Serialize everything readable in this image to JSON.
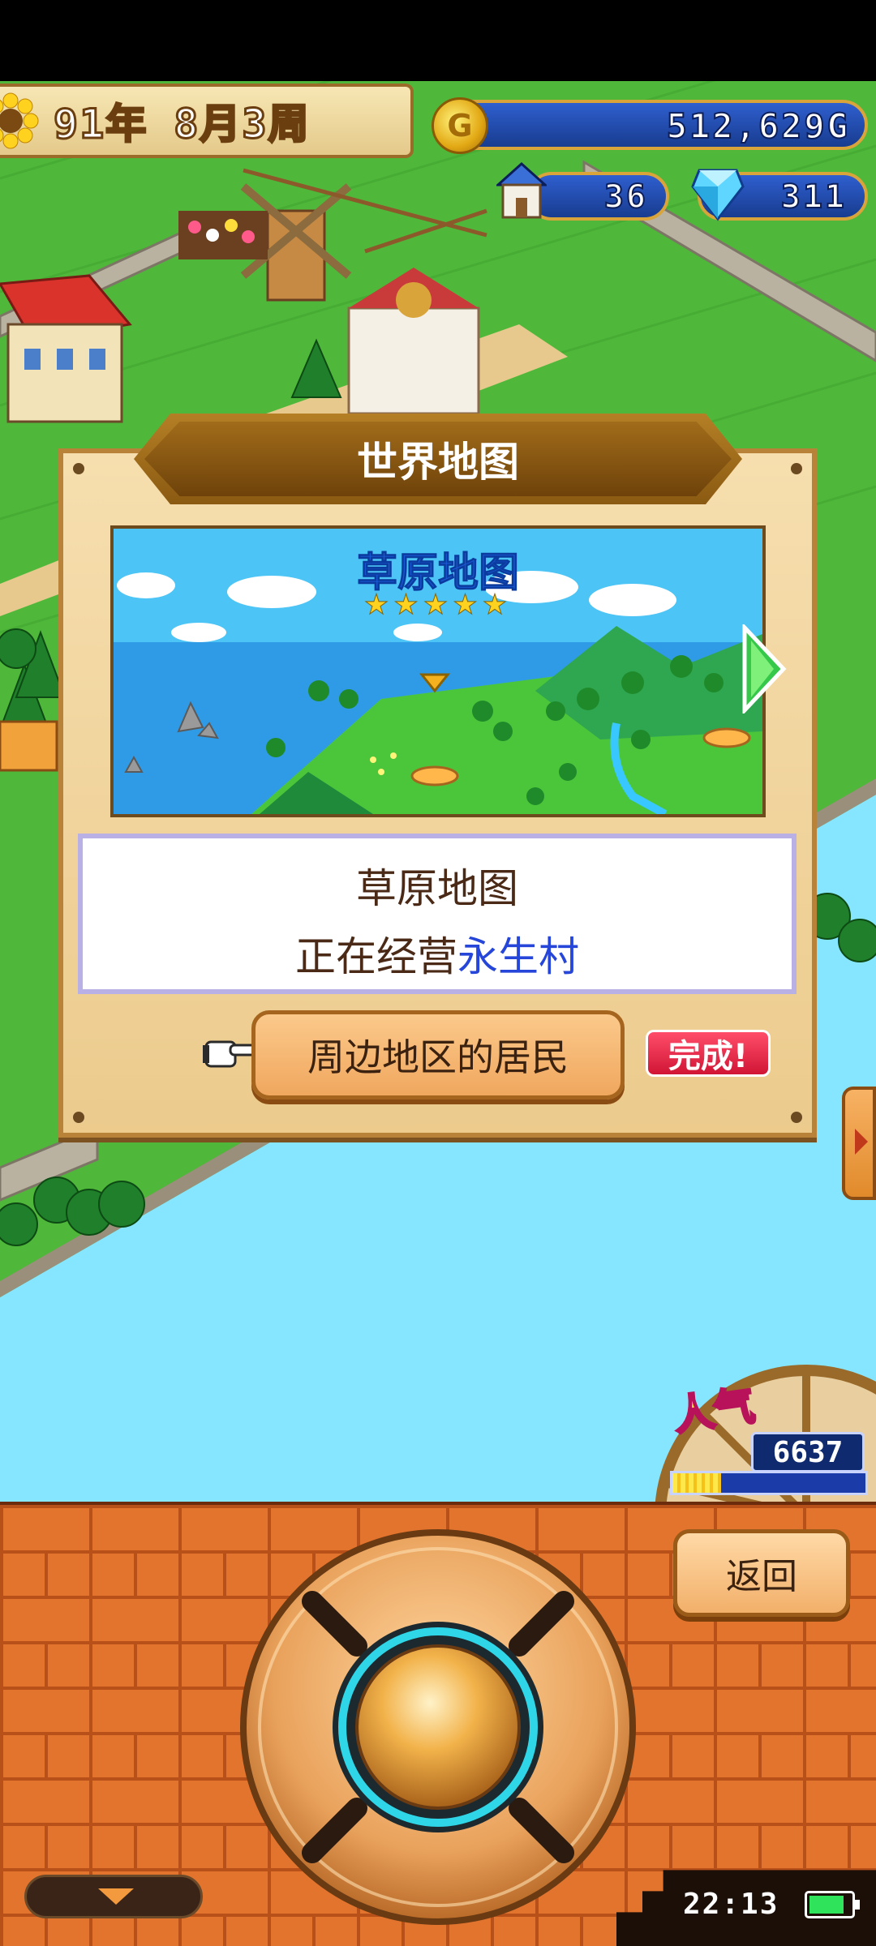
{
  "hud": {
    "date": "91年 8月3周",
    "coin_icon_letter": "G",
    "gold": "512,629G",
    "population": "36",
    "gems": "311"
  },
  "dialog": {
    "title": "世界地图",
    "map_name": "草原地图",
    "map_rating_stars": 5,
    "stars_text": "★★★★★",
    "info_line1": "草原地图",
    "info_line2_prefix": "正在经营",
    "info_line2_highlight": "永生村",
    "residents_button": "周边地区的居民",
    "complete_badge": "完成!"
  },
  "popularity": {
    "label": "人气",
    "value": "6637",
    "bar_fraction": 0.25
  },
  "bottom": {
    "back_button": "返回",
    "clock": "22:13",
    "battery_fraction": 0.85
  },
  "colors": {
    "accent_gold": "#d9a43a",
    "hud_blue": "#2f5fcf",
    "highlight_blue": "#2546d8",
    "complete_red": "#d11535",
    "brick": "#e3742e"
  }
}
